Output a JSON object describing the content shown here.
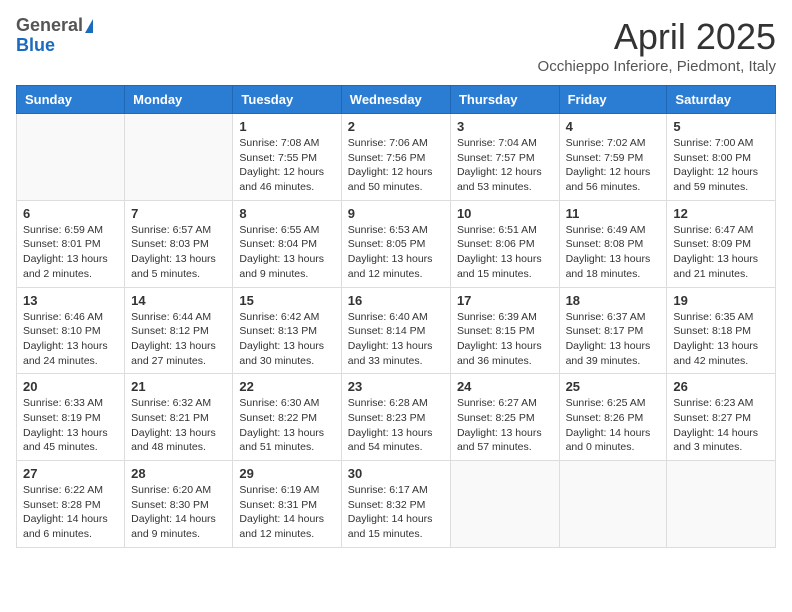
{
  "header": {
    "logo_general": "General",
    "logo_blue": "Blue",
    "month_title": "April 2025",
    "location": "Occhieppo Inferiore, Piedmont, Italy"
  },
  "weekdays": [
    "Sunday",
    "Monday",
    "Tuesday",
    "Wednesday",
    "Thursday",
    "Friday",
    "Saturday"
  ],
  "weeks": [
    [
      null,
      null,
      {
        "day": 1,
        "sunrise": "Sunrise: 7:08 AM",
        "sunset": "Sunset: 7:55 PM",
        "daylight": "Daylight: 12 hours and 46 minutes."
      },
      {
        "day": 2,
        "sunrise": "Sunrise: 7:06 AM",
        "sunset": "Sunset: 7:56 PM",
        "daylight": "Daylight: 12 hours and 50 minutes."
      },
      {
        "day": 3,
        "sunrise": "Sunrise: 7:04 AM",
        "sunset": "Sunset: 7:57 PM",
        "daylight": "Daylight: 12 hours and 53 minutes."
      },
      {
        "day": 4,
        "sunrise": "Sunrise: 7:02 AM",
        "sunset": "Sunset: 7:59 PM",
        "daylight": "Daylight: 12 hours and 56 minutes."
      },
      {
        "day": 5,
        "sunrise": "Sunrise: 7:00 AM",
        "sunset": "Sunset: 8:00 PM",
        "daylight": "Daylight: 12 hours and 59 minutes."
      }
    ],
    [
      {
        "day": 6,
        "sunrise": "Sunrise: 6:59 AM",
        "sunset": "Sunset: 8:01 PM",
        "daylight": "Daylight: 13 hours and 2 minutes."
      },
      {
        "day": 7,
        "sunrise": "Sunrise: 6:57 AM",
        "sunset": "Sunset: 8:03 PM",
        "daylight": "Daylight: 13 hours and 5 minutes."
      },
      {
        "day": 8,
        "sunrise": "Sunrise: 6:55 AM",
        "sunset": "Sunset: 8:04 PM",
        "daylight": "Daylight: 13 hours and 9 minutes."
      },
      {
        "day": 9,
        "sunrise": "Sunrise: 6:53 AM",
        "sunset": "Sunset: 8:05 PM",
        "daylight": "Daylight: 13 hours and 12 minutes."
      },
      {
        "day": 10,
        "sunrise": "Sunrise: 6:51 AM",
        "sunset": "Sunset: 8:06 PM",
        "daylight": "Daylight: 13 hours and 15 minutes."
      },
      {
        "day": 11,
        "sunrise": "Sunrise: 6:49 AM",
        "sunset": "Sunset: 8:08 PM",
        "daylight": "Daylight: 13 hours and 18 minutes."
      },
      {
        "day": 12,
        "sunrise": "Sunrise: 6:47 AM",
        "sunset": "Sunset: 8:09 PM",
        "daylight": "Daylight: 13 hours and 21 minutes."
      }
    ],
    [
      {
        "day": 13,
        "sunrise": "Sunrise: 6:46 AM",
        "sunset": "Sunset: 8:10 PM",
        "daylight": "Daylight: 13 hours and 24 minutes."
      },
      {
        "day": 14,
        "sunrise": "Sunrise: 6:44 AM",
        "sunset": "Sunset: 8:12 PM",
        "daylight": "Daylight: 13 hours and 27 minutes."
      },
      {
        "day": 15,
        "sunrise": "Sunrise: 6:42 AM",
        "sunset": "Sunset: 8:13 PM",
        "daylight": "Daylight: 13 hours and 30 minutes."
      },
      {
        "day": 16,
        "sunrise": "Sunrise: 6:40 AM",
        "sunset": "Sunset: 8:14 PM",
        "daylight": "Daylight: 13 hours and 33 minutes."
      },
      {
        "day": 17,
        "sunrise": "Sunrise: 6:39 AM",
        "sunset": "Sunset: 8:15 PM",
        "daylight": "Daylight: 13 hours and 36 minutes."
      },
      {
        "day": 18,
        "sunrise": "Sunrise: 6:37 AM",
        "sunset": "Sunset: 8:17 PM",
        "daylight": "Daylight: 13 hours and 39 minutes."
      },
      {
        "day": 19,
        "sunrise": "Sunrise: 6:35 AM",
        "sunset": "Sunset: 8:18 PM",
        "daylight": "Daylight: 13 hours and 42 minutes."
      }
    ],
    [
      {
        "day": 20,
        "sunrise": "Sunrise: 6:33 AM",
        "sunset": "Sunset: 8:19 PM",
        "daylight": "Daylight: 13 hours and 45 minutes."
      },
      {
        "day": 21,
        "sunrise": "Sunrise: 6:32 AM",
        "sunset": "Sunset: 8:21 PM",
        "daylight": "Daylight: 13 hours and 48 minutes."
      },
      {
        "day": 22,
        "sunrise": "Sunrise: 6:30 AM",
        "sunset": "Sunset: 8:22 PM",
        "daylight": "Daylight: 13 hours and 51 minutes."
      },
      {
        "day": 23,
        "sunrise": "Sunrise: 6:28 AM",
        "sunset": "Sunset: 8:23 PM",
        "daylight": "Daylight: 13 hours and 54 minutes."
      },
      {
        "day": 24,
        "sunrise": "Sunrise: 6:27 AM",
        "sunset": "Sunset: 8:25 PM",
        "daylight": "Daylight: 13 hours and 57 minutes."
      },
      {
        "day": 25,
        "sunrise": "Sunrise: 6:25 AM",
        "sunset": "Sunset: 8:26 PM",
        "daylight": "Daylight: 14 hours and 0 minutes."
      },
      {
        "day": 26,
        "sunrise": "Sunrise: 6:23 AM",
        "sunset": "Sunset: 8:27 PM",
        "daylight": "Daylight: 14 hours and 3 minutes."
      }
    ],
    [
      {
        "day": 27,
        "sunrise": "Sunrise: 6:22 AM",
        "sunset": "Sunset: 8:28 PM",
        "daylight": "Daylight: 14 hours and 6 minutes."
      },
      {
        "day": 28,
        "sunrise": "Sunrise: 6:20 AM",
        "sunset": "Sunset: 8:30 PM",
        "daylight": "Daylight: 14 hours and 9 minutes."
      },
      {
        "day": 29,
        "sunrise": "Sunrise: 6:19 AM",
        "sunset": "Sunset: 8:31 PM",
        "daylight": "Daylight: 14 hours and 12 minutes."
      },
      {
        "day": 30,
        "sunrise": "Sunrise: 6:17 AM",
        "sunset": "Sunset: 8:32 PM",
        "daylight": "Daylight: 14 hours and 15 minutes."
      },
      null,
      null,
      null
    ]
  ]
}
